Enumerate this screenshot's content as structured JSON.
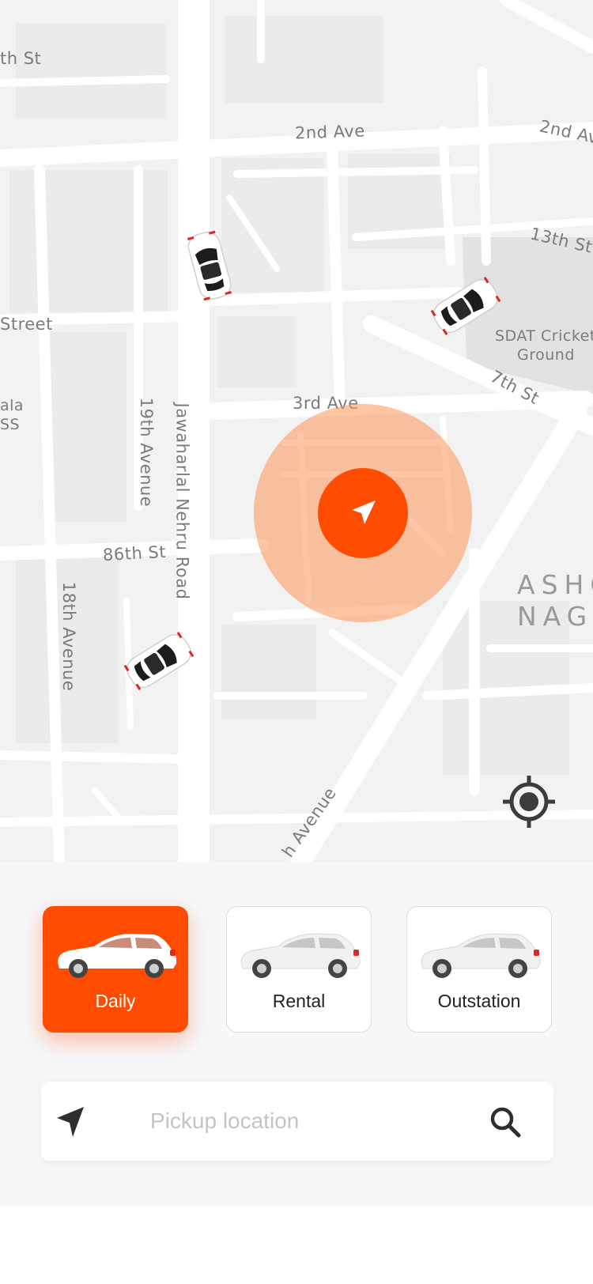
{
  "map": {
    "street_labels": [
      "th St",
      "2nd Ave",
      "2nd Av",
      "13th St",
      "Street",
      "SDAT Cricket",
      "Ground",
      "7th St",
      "3rd Ave",
      "ala",
      "SS",
      "19th Avenue",
      "Jawaharlal Nehru Road",
      "86th St",
      "18th Avenue",
      "h Avenue"
    ],
    "area_label_line1": "ASHO",
    "area_label_line2": "NAGA",
    "colors": {
      "background": "#f2f2f2",
      "road": "#ffffff",
      "block": "#ebebeb",
      "park": "#e2e2e2",
      "accent": "#ff4c00",
      "pulse": "#fc965a"
    },
    "icons": [
      "car-icon",
      "navigation-arrow-icon",
      "my-location-icon"
    ]
  },
  "ride_types": [
    {
      "label": "Daily",
      "selected": true
    },
    {
      "label": "Rental",
      "selected": false
    },
    {
      "label": "Outstation",
      "selected": false
    }
  ],
  "search": {
    "placeholder": "Pickup location",
    "value": ""
  }
}
